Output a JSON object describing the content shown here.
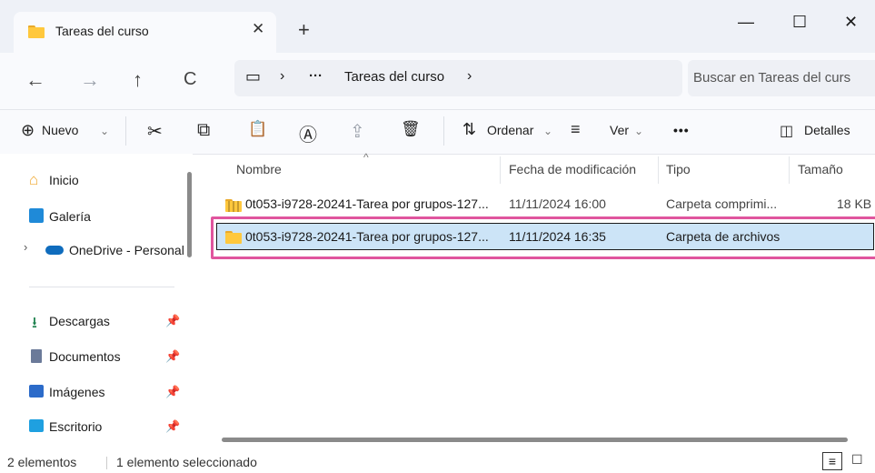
{
  "tab": {
    "title": "Tareas del curso",
    "close_glyph": "✕",
    "new_tab_glyph": "+"
  },
  "window_controls": {
    "minimize": "—",
    "maximize": "☐",
    "close": "✕"
  },
  "nav": {
    "back_glyph": "←",
    "forward_glyph": "→",
    "up_glyph": "↑",
    "refresh_glyph": "C",
    "address": {
      "device_glyph": "▭",
      "sep1": "›",
      "ellipsis": "···",
      "folder": "Tareas del curso",
      "sep2": "›"
    },
    "search_placeholder": "Buscar en Tareas del curs"
  },
  "toolbar": {
    "new_icon": "⊕",
    "new_label": "Nuevo",
    "cut_icon": "✂",
    "copy_icon": "⧉",
    "paste_icon": "📋",
    "rename_icon": "Ⓐ",
    "share_icon": "⇪",
    "delete_icon": "🗑",
    "sort_icon": "⇅",
    "sort_label": "Ordenar",
    "view_icon": "≡",
    "view_label": "Ver",
    "more": "•••",
    "details_icon": "◫",
    "details_label": "Detalles",
    "chevron": "⌄"
  },
  "sidebar": {
    "items": [
      {
        "label": "Inicio"
      },
      {
        "label": "Galería"
      },
      {
        "label": "OneDrive - Personal"
      }
    ],
    "quick": [
      {
        "label": "Descargas",
        "pin": "📌"
      },
      {
        "label": "Documentos",
        "pin": "📌"
      },
      {
        "label": "Imágenes",
        "pin": "📌"
      },
      {
        "label": "Escritorio",
        "pin": "📌"
      }
    ],
    "expand_glyph": "›"
  },
  "columns": {
    "name": "Nombre",
    "date": "Fecha de modificación",
    "type": "Tipo",
    "size": "Tamaño",
    "sort_glyph": "^"
  },
  "files": [
    {
      "name": "0t053-i9728-20241-Tarea por grupos-127...",
      "date": "11/11/2024 16:00",
      "type": "Carpeta comprimi...",
      "size": "18 KB"
    },
    {
      "name": "0t053-i9728-20241-Tarea por grupos-127...",
      "date": "11/11/2024 16:35",
      "type": "Carpeta de archivos",
      "size": ""
    }
  ],
  "status": {
    "count": "2 elementos",
    "selected": "1 elemento seleccionado"
  },
  "colors": {
    "selection": "#cce4f7",
    "highlight": "#e0559e",
    "folder": "#ffc83d"
  }
}
